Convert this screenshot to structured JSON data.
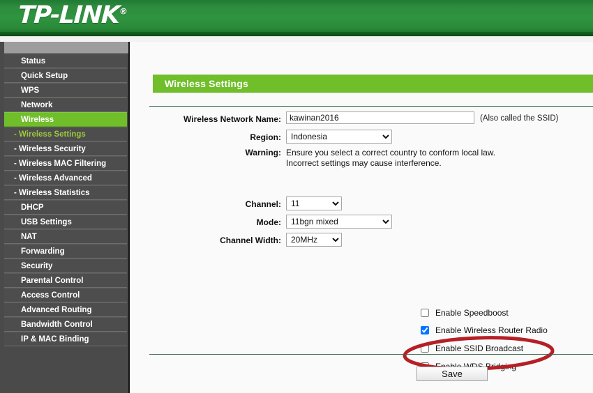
{
  "header": {
    "brand": "TP-LINK",
    "registered_mark": "®"
  },
  "sidebar": {
    "items": [
      {
        "label": "Status",
        "state": "normal",
        "sub": false
      },
      {
        "label": "Quick Setup",
        "state": "normal",
        "sub": false
      },
      {
        "label": "WPS",
        "state": "normal",
        "sub": false
      },
      {
        "label": "Network",
        "state": "normal",
        "sub": false
      },
      {
        "label": "Wireless",
        "state": "active",
        "sub": false
      },
      {
        "label": "- Wireless Settings",
        "state": "active-sub",
        "sub": true
      },
      {
        "label": "- Wireless Security",
        "state": "normal",
        "sub": true
      },
      {
        "label": "- Wireless MAC Filtering",
        "state": "normal",
        "sub": true
      },
      {
        "label": "- Wireless Advanced",
        "state": "normal",
        "sub": true
      },
      {
        "label": "- Wireless Statistics",
        "state": "normal",
        "sub": true
      },
      {
        "label": "DHCP",
        "state": "normal",
        "sub": false
      },
      {
        "label": "USB Settings",
        "state": "normal",
        "sub": false
      },
      {
        "label": "NAT",
        "state": "normal",
        "sub": false
      },
      {
        "label": "Forwarding",
        "state": "normal",
        "sub": false
      },
      {
        "label": "Security",
        "state": "normal",
        "sub": false
      },
      {
        "label": "Parental Control",
        "state": "normal",
        "sub": false
      },
      {
        "label": "Access Control",
        "state": "normal",
        "sub": false
      },
      {
        "label": "Advanced Routing",
        "state": "normal",
        "sub": false
      },
      {
        "label": "Bandwidth Control",
        "state": "normal",
        "sub": false
      },
      {
        "label": "IP & MAC Binding",
        "state": "normal",
        "sub": false
      }
    ]
  },
  "main": {
    "page_title": "Wireless Settings",
    "fields": {
      "ssid_label": "Wireless Network Name:",
      "ssid_value": "kawinan2016",
      "ssid_hint": "(Also called the SSID)",
      "region_label": "Region:",
      "region_value": "Indonesia",
      "warning_label": "Warning:",
      "warning_line1": "Ensure you select a correct country to conform local law.",
      "warning_line2": "Incorrect settings may cause interference.",
      "channel_label": "Channel:",
      "channel_value": "11",
      "mode_label": "Mode:",
      "mode_value": "11bgn mixed",
      "channel_width_label": "Channel Width:",
      "channel_width_value": "20MHz"
    },
    "checkboxes": [
      {
        "label": "Enable Speedboost",
        "checked": false
      },
      {
        "label": "Enable Wireless Router Radio",
        "checked": true
      },
      {
        "label": "Enable SSID Broadcast",
        "checked": false
      },
      {
        "label": "Enable WDS Bridging",
        "checked": false
      }
    ],
    "save_label": "Save"
  },
  "annotation": {
    "shape": "ellipse",
    "color": "#b51f26",
    "targets": "Enable SSID Broadcast"
  },
  "colors": {
    "brand_green": "#2f9440",
    "accent_green": "#6fbe2a",
    "sidebar_bg": "#4d4d4d",
    "sub_active_text": "#9fc83c",
    "annotation_red": "#b51f26"
  }
}
